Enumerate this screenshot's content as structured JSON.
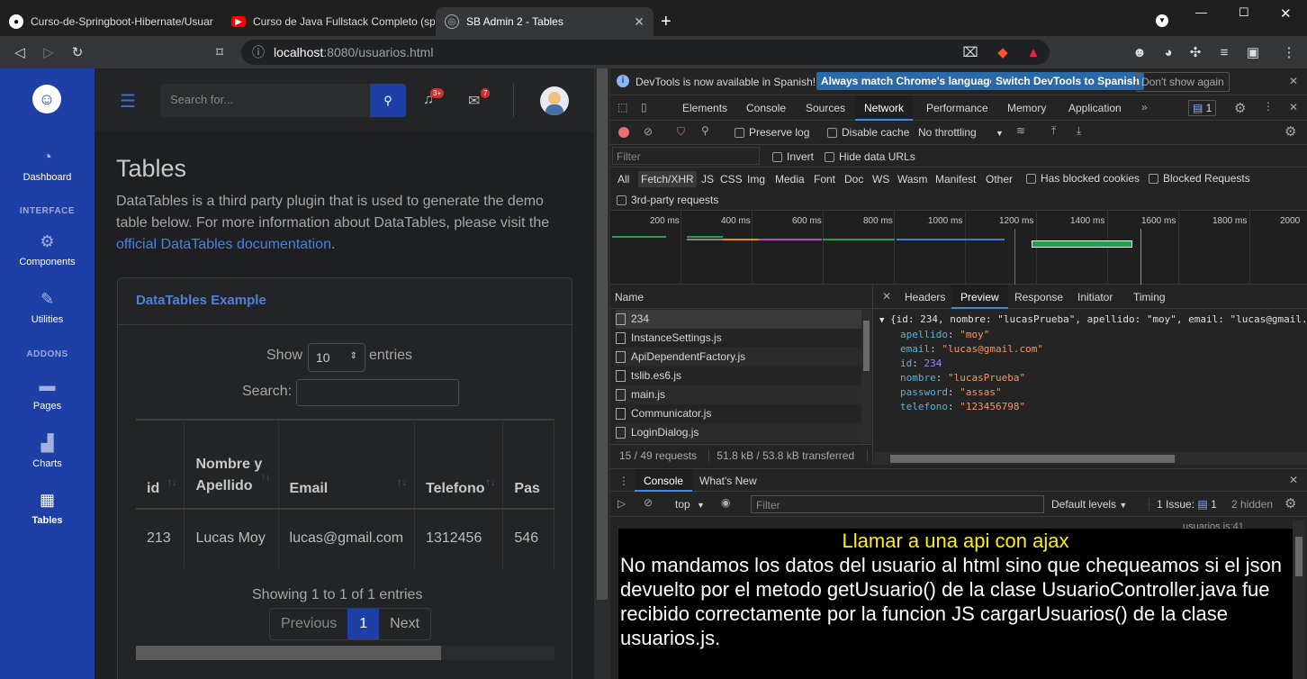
{
  "browser": {
    "tabs": [
      {
        "title": "Curso-de-Springboot-Hibernate/Usuar",
        "icon": "github-icon"
      },
      {
        "title": "Curso de Java Fullstack Completo (spr",
        "icon": "youtube-icon"
      },
      {
        "title": "SB Admin 2 - Tables",
        "icon": "globe-icon",
        "active": true
      }
    ],
    "url_host": "localhost",
    "url_path": ":8080/usuarios.html"
  },
  "page": {
    "search_placeholder": "Search for...",
    "alerts_badge": "3+",
    "messages_badge": "7",
    "sidebar": {
      "dashboard": "Dashboard",
      "interface_heading": "INTERFACE",
      "components": "Components",
      "utilities": "Utilities",
      "addons_heading": "ADDONS",
      "pages": "Pages",
      "charts": "Charts",
      "tables": "Tables"
    },
    "title": "Tables",
    "intro_text": "DataTables is a third party plugin that is used to generate the demo table below. For more information about DataTables, please visit the ",
    "intro_link": "official DataTables documentation",
    "intro_end": ".",
    "card_title": "DataTables Example",
    "show_label": "Show",
    "show_value": "10",
    "entries_label": "entries",
    "search_label": "Search:",
    "columns": [
      "id",
      "Nombre y Apellido",
      "Email",
      "Telefono",
      "Pas"
    ],
    "rows": [
      [
        "213",
        "Lucas Moy",
        "lucas@gmail.com",
        "1312456",
        "546"
      ]
    ],
    "info": "Showing 1 to 1 of 1 entries",
    "pager": {
      "previous": "Previous",
      "current": "1",
      "next": "Next"
    }
  },
  "devtools": {
    "notice": "DevTools is now available in Spanish!",
    "btn_match": "Always match Chrome's language",
    "btn_switch": "Switch DevTools to Spanish",
    "btn_dont": "Don't show again",
    "tabs": [
      "Elements",
      "Console",
      "Sources",
      "Network",
      "Performance",
      "Memory",
      "Application"
    ],
    "issues_count": "1",
    "preserve_log": "Preserve log",
    "disable_cache": "Disable cache",
    "throttling": "No throttling",
    "filter_placeholder": "Filter",
    "invert": "Invert",
    "hide_data_urls": "Hide data URLs",
    "filter_types": [
      "All",
      "Fetch/XHR",
      "JS",
      "CSS",
      "Img",
      "Media",
      "Font",
      "Doc",
      "WS",
      "Wasm",
      "Manifest",
      "Other"
    ],
    "has_blocked_cookies": "Has blocked cookies",
    "blocked_requests": "Blocked Requests",
    "third_party": "3rd-party requests",
    "ticks": [
      "200 ms",
      "400 ms",
      "600 ms",
      "800 ms",
      "1000 ms",
      "1200 ms",
      "1400 ms",
      "1600 ms",
      "1800 ms",
      "2000"
    ],
    "name_header": "Name",
    "requests": [
      "234",
      "InstanceSettings.js",
      "ApiDependentFactory.js",
      "tslib.es6.js",
      "main.js",
      "Communicator.js",
      "LoginDialog.js"
    ],
    "status": "15 / 49 requests",
    "transferred": "51.8 kB / 53.8 kB transferred",
    "status_cut": "5",
    "detail_tabs": [
      "Headers",
      "Preview",
      "Response",
      "Initiator",
      "Timing"
    ],
    "preview_summary": "{id: 234, nombre: \"lucasPrueba\", apellido: \"moy\", email: \"lucas@gmail.",
    "preview_fields": [
      {
        "k": "apellido",
        "v": "\"moy\"",
        "t": "str"
      },
      {
        "k": "email",
        "v": "\"lucas@gmail.com\"",
        "t": "str"
      },
      {
        "k": "id",
        "v": "234",
        "t": "num"
      },
      {
        "k": "nombre",
        "v": "\"lucasPrueba\"",
        "t": "str"
      },
      {
        "k": "password",
        "v": "\"assas\"",
        "t": "str"
      },
      {
        "k": "telefono",
        "v": "\"123456798\"",
        "t": "str"
      }
    ],
    "drawer_tabs": [
      "Console",
      "What's New"
    ],
    "context": "top",
    "console_filter": "Filter",
    "default_levels": "Default levels",
    "issue_label": "1 Issue:",
    "issue_count": "1",
    "hidden": "2 hidden",
    "source_ref": "usuarios.js:41"
  },
  "overlay": {
    "title": "Llamar a una api con ajax",
    "body": "No mandamos los datos del usuario al html sino que chequeamos si el json devuelto por el metodo getUsuario() de la clase UsuarioController.java fue recibido correctamente por la funcion JS cargarUsuarios() de la clase usuarios.js."
  }
}
